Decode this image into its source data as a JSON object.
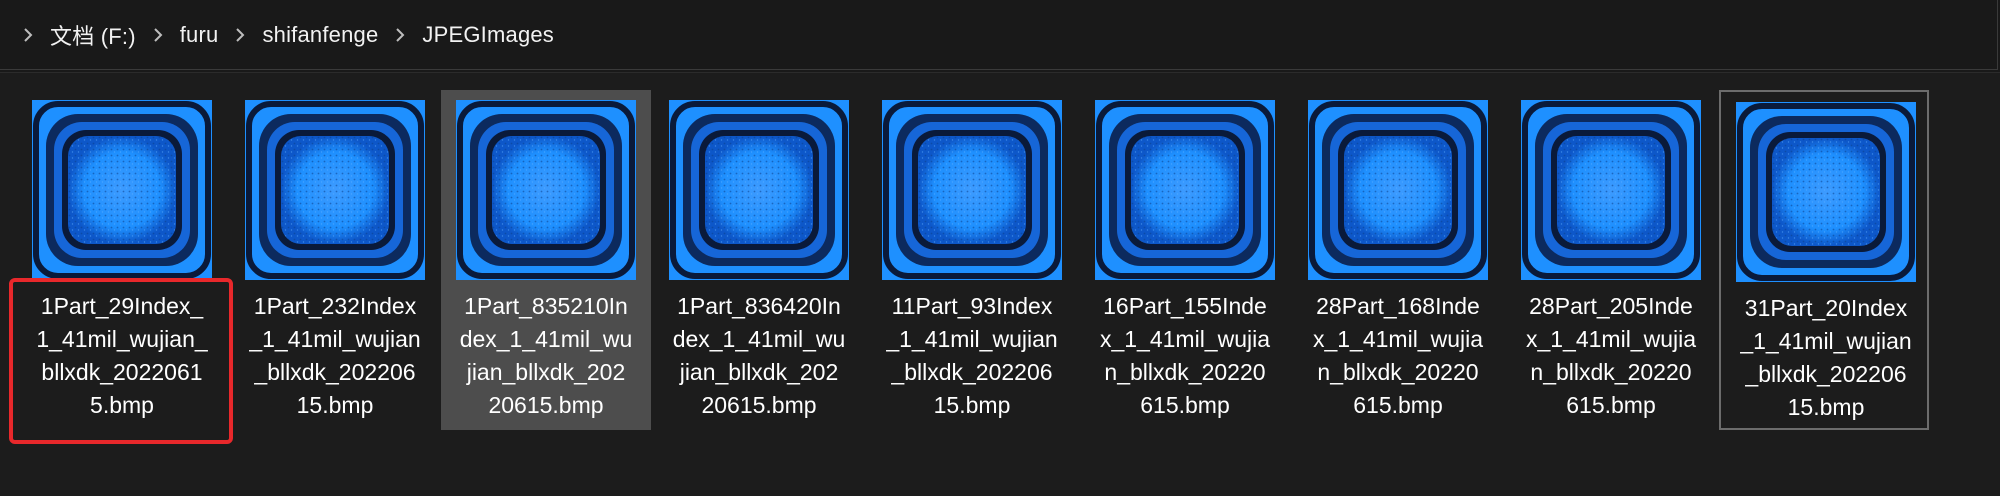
{
  "breadcrumb": {
    "items": [
      "文档 (F:)",
      "furu",
      "shifanfenge",
      "JPEGImages"
    ]
  },
  "files": [
    {
      "caption": "1Part_29Index_\n1_41mil_wujian_\nbllxdk_2022061\n5.bmp",
      "state": "red-highlight"
    },
    {
      "caption": "1Part_232Index\n_1_41mil_wujian\n_bllxdk_202206\n15.bmp",
      "state": "normal"
    },
    {
      "caption": "1Part_835210In\ndex_1_41mil_wu\njian_bllxdk_202\n20615.bmp",
      "state": "selected"
    },
    {
      "caption": "1Part_836420In\ndex_1_41mil_wu\njian_bllxdk_202\n20615.bmp",
      "state": "normal"
    },
    {
      "caption": "11Part_93Index\n_1_41mil_wujian\n_bllxdk_202206\n15.bmp",
      "state": "normal"
    },
    {
      "caption": "16Part_155Inde\nx_1_41mil_wujia\nn_bllxdk_20220\n615.bmp",
      "state": "normal"
    },
    {
      "caption": "28Part_168Inde\nx_1_41mil_wujia\nn_bllxdk_20220\n615.bmp",
      "state": "normal"
    },
    {
      "caption": "28Part_205Inde\nx_1_41mil_wujia\nn_bllxdk_20220\n615.bmp",
      "state": "normal"
    },
    {
      "caption": "31Part_20Index\n_1_41mil_wujian\n_bllxdk_202206\n15.bmp",
      "state": "focused"
    }
  ],
  "colors": {
    "background": "#1c1c1c",
    "thumb_blue": "#1e90ff",
    "thumb_dark": "#0a1a3a",
    "highlight_red": "#e8282b",
    "selected_bg": "#4d4d4d"
  }
}
